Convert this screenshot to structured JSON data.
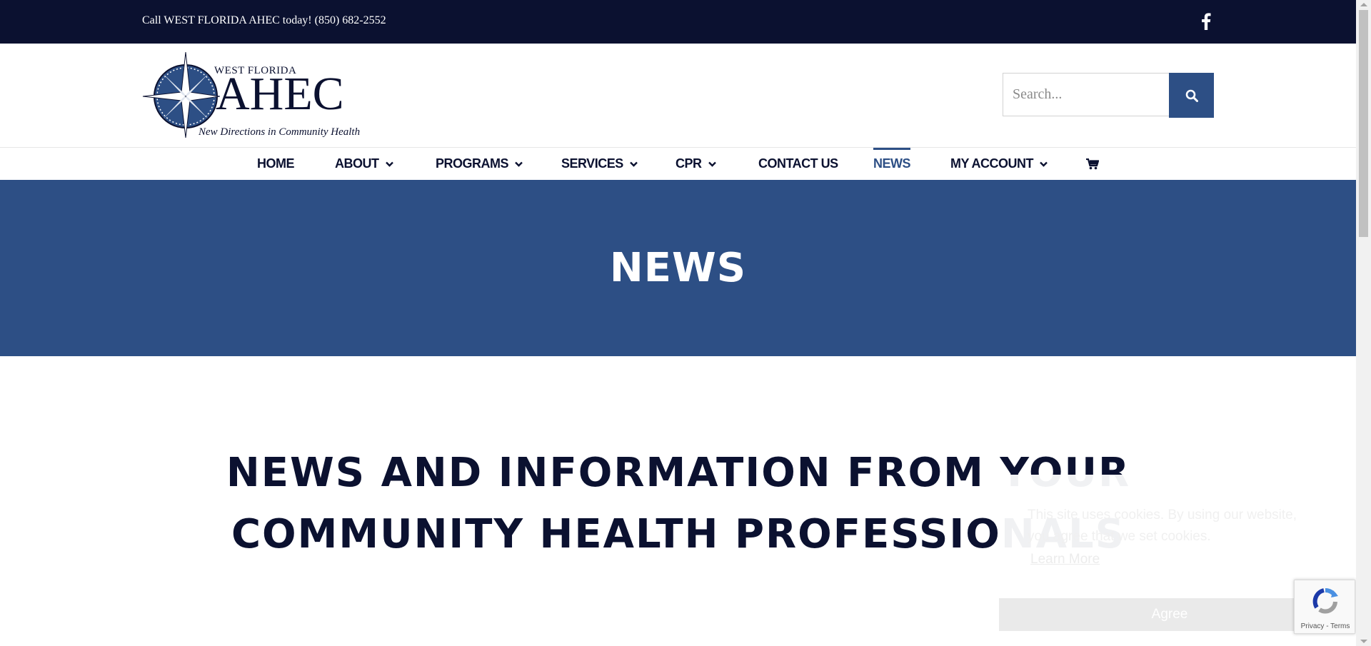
{
  "topbar": {
    "call_text": "Call WEST FLORIDA AHEC today! (850) 682-2552",
    "social_icon": "facebook-icon"
  },
  "logo": {
    "top_text": "WEST FLORIDA",
    "main_text": "AHEC",
    "tagline": "New Directions in Community Health"
  },
  "search": {
    "placeholder": "Search...",
    "button_icon": "search-icon"
  },
  "nav": {
    "items": [
      {
        "label": "HOME"
      },
      {
        "label": "ABOUT"
      },
      {
        "label": "PROGRAMS"
      },
      {
        "label": "SERVICES"
      },
      {
        "label": "CPR"
      },
      {
        "label": "CONTACT US"
      },
      {
        "label": "NEWS"
      },
      {
        "label": "MY ACCOUNT"
      },
      {
        "label": "",
        "icon": "cart-icon"
      }
    ],
    "active": "NEWS"
  },
  "page_title": "NEWS",
  "headline": "NEWS AND INFORMATION FROM YOUR COMMUNITY HEALTH PROFESSIONALS",
  "cookie": {
    "message": "This site uses cookies. By using our website, you agree that we set cookies.",
    "learn_more": "Learn More",
    "agree": "Agree"
  },
  "recaptcha": {
    "terms": "Privacy - Terms"
  },
  "colors": {
    "topbar": "#0b1130",
    "accent": "#2d4f85",
    "text_dark": "#0b1130"
  }
}
